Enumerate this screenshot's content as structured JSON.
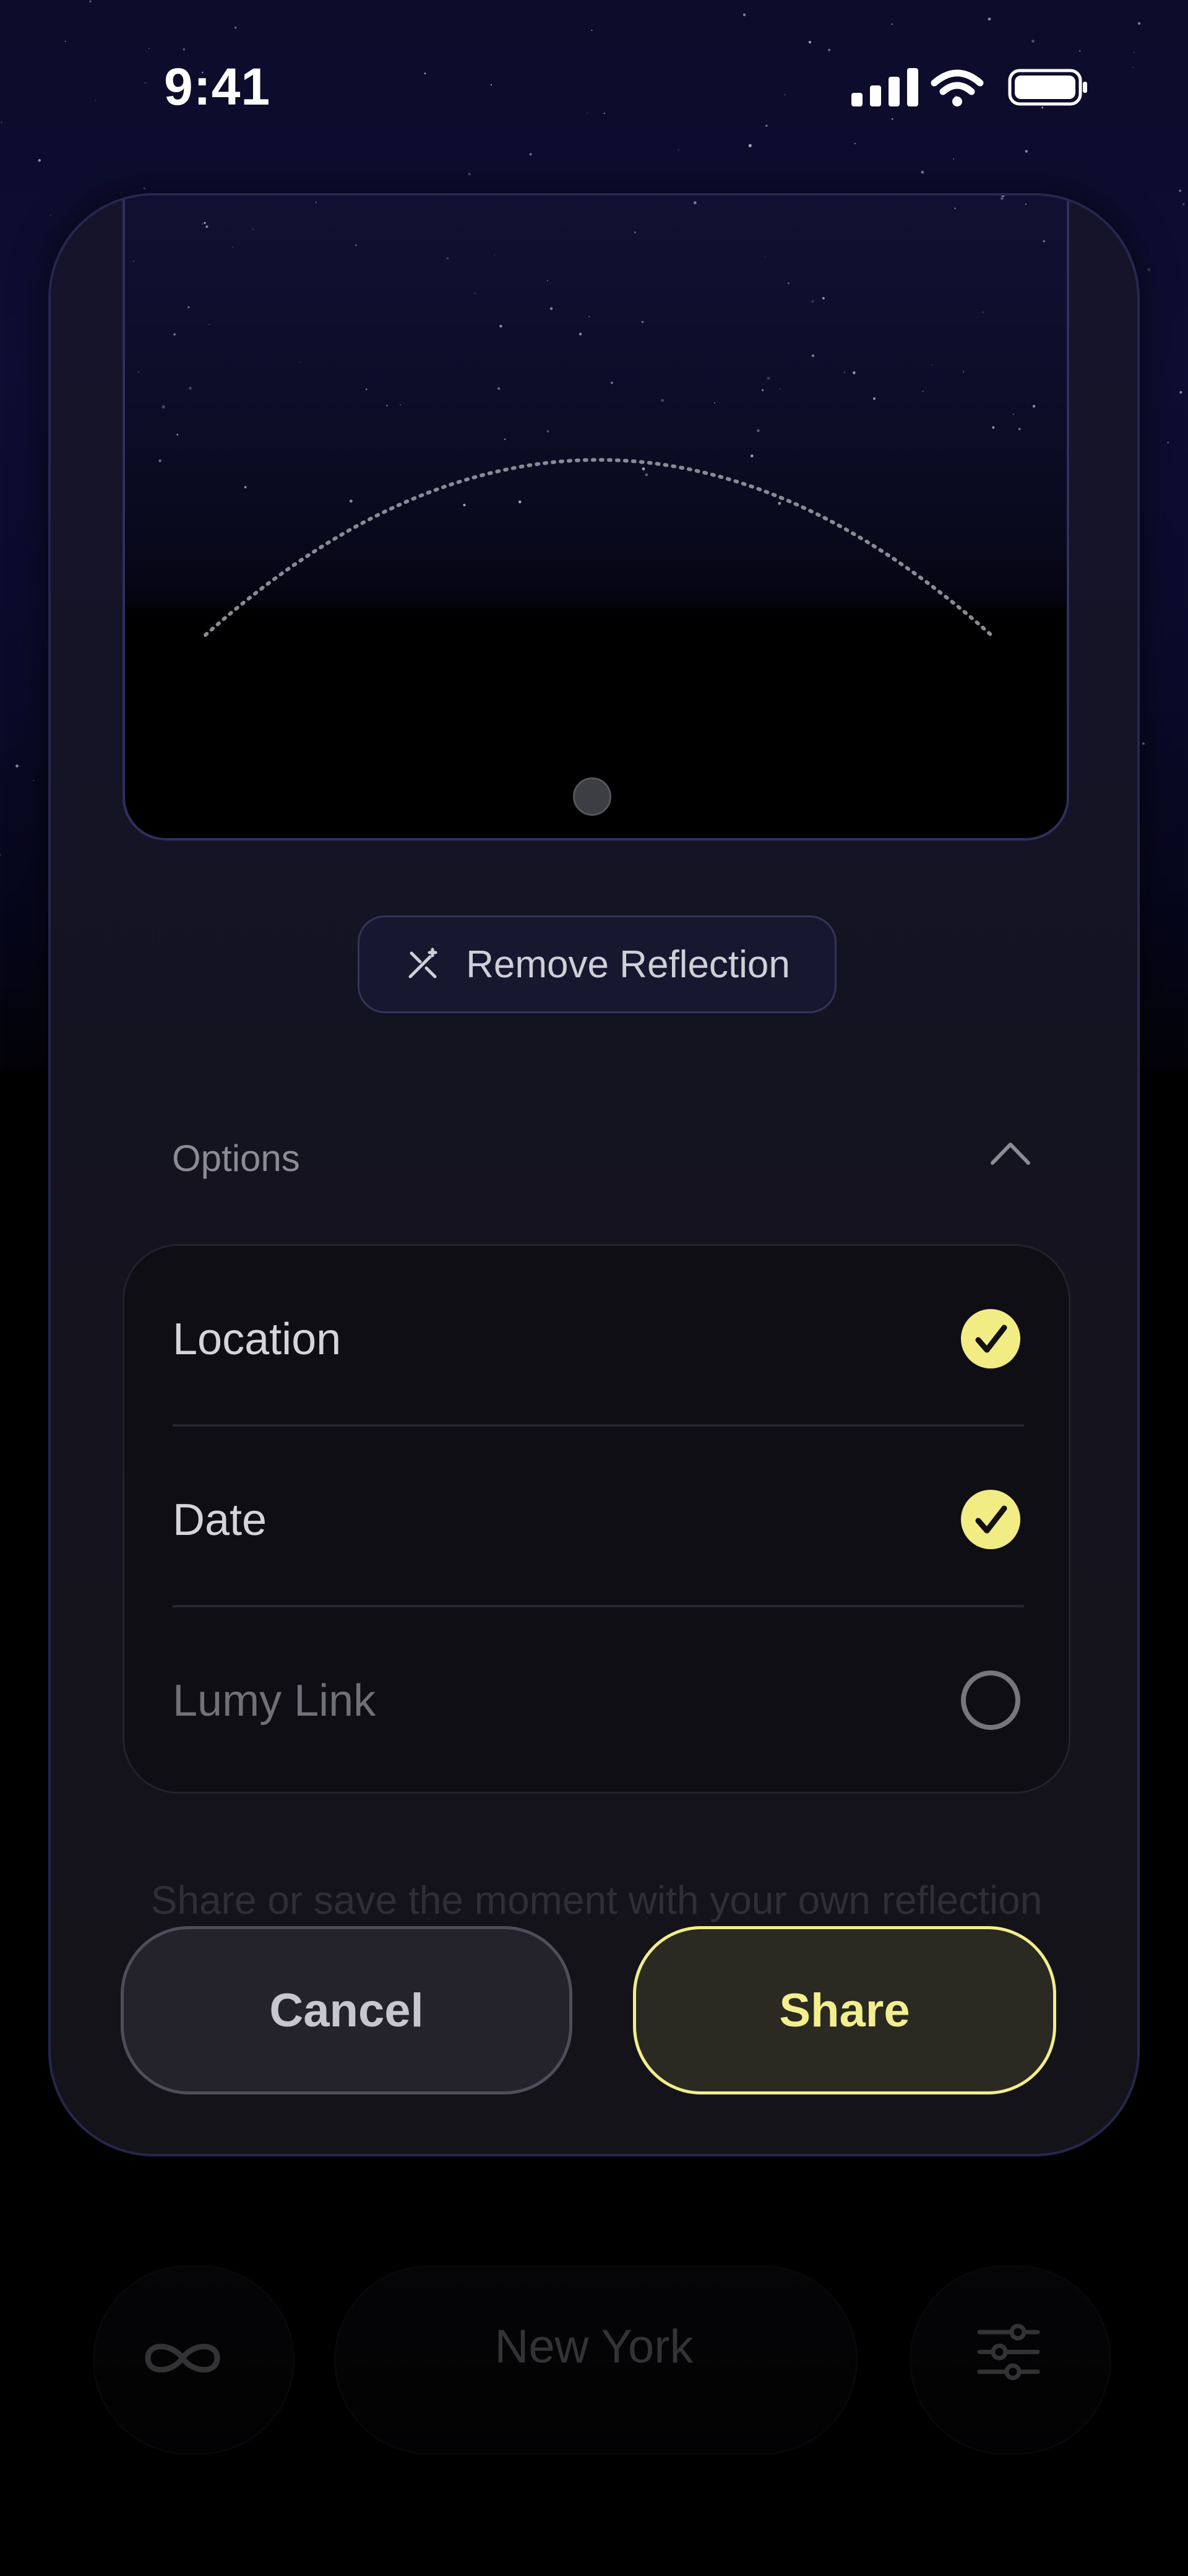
{
  "status_bar": {
    "time": "9:41",
    "signal_icon": "cellular-signal-icon",
    "wifi_icon": "wifi-icon",
    "battery_icon": "battery-icon"
  },
  "sheet": {
    "remove_reflection": {
      "icon": "sparkle-remove-icon",
      "label": "Remove Reflection"
    },
    "options": {
      "title": "Options",
      "expanded": true,
      "items": [
        {
          "label": "Location",
          "checked": true
        },
        {
          "label": "Date",
          "checked": true
        },
        {
          "label": "Lumy Link",
          "checked": false
        }
      ]
    },
    "caption": "Share or save the moment with your own reflection",
    "actions": {
      "cancel": "Cancel",
      "share": "Share"
    }
  },
  "bottom_nav": {
    "left_icon": "infinity-icon",
    "city": "New York",
    "right_icon": "sliders-icon"
  },
  "colors": {
    "accent": "#f4ef8e",
    "check_fill": "#f1ec84",
    "sky_top": "#0e0d33",
    "sheet_border": "#26264f"
  }
}
